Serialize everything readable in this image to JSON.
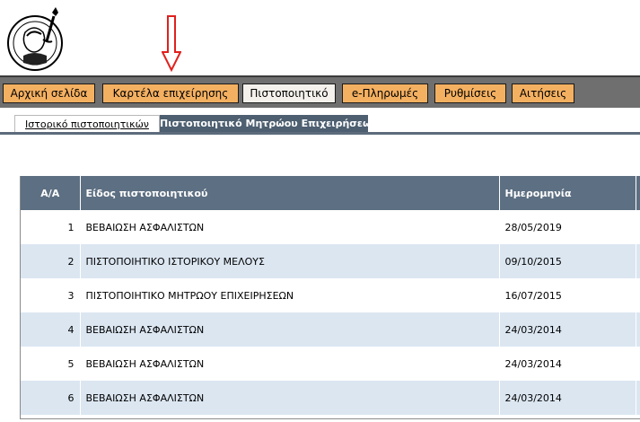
{
  "logo": {
    "alt": "Seal logo",
    "seal_text": "ΠΡΟΜΗΘΕΥΣ"
  },
  "nav": {
    "items": [
      {
        "label": "Αρχική σελίδα",
        "active": false
      },
      {
        "label": "Καρτέλα επιχείρησης",
        "active": false
      },
      {
        "label": "Πιστοποιητικό",
        "active": true
      },
      {
        "label": "e-Πληρωμές",
        "active": false
      },
      {
        "label": "Ρυθμίσεις",
        "active": false
      },
      {
        "label": "Αιτήσεις",
        "active": false
      }
    ]
  },
  "subnav": {
    "active_tab": "Ιστορικό πιστοποιητικών",
    "other_tab": "Πιστοποιητικό Μητρώου Επιχειρήσεων"
  },
  "table": {
    "headers": {
      "aa": "Α/Α",
      "type": "Είδος πιστοποιητικού",
      "date": "Ημερομηνία"
    },
    "rows": [
      {
        "aa": "1",
        "type": "ΒΕΒΑΙΩΣΗ ΑΣΦΑΛΙΣΤΩΝ",
        "date": "28/05/2019"
      },
      {
        "aa": "2",
        "type": "ΠΙΣΤΟΠΟΙΗΤΙΚΟ ΙΣΤΟΡΙΚΟΥ ΜΕΛΟΥΣ",
        "date": "09/10/2015"
      },
      {
        "aa": "3",
        "type": "ΠΙΣΤΟΠΟΙΗΤΙΚΟ ΜΗΤΡΩΟΥ ΕΠΙΧΕΙΡΗΣΕΩΝ",
        "date": "16/07/2015"
      },
      {
        "aa": "4",
        "type": "ΒΕΒΑΙΩΣΗ ΑΣΦΑΛΙΣΤΩΝ",
        "date": "24/03/2014"
      },
      {
        "aa": "5",
        "type": "ΒΕΒΑΙΩΣΗ ΑΣΦΑΛΙΣΤΩΝ",
        "date": "24/03/2014"
      },
      {
        "aa": "6",
        "type": "ΒΕΒΑΙΩΣΗ ΑΣΦΑΛΙΣΤΩΝ",
        "date": "24/03/2014"
      }
    ]
  },
  "colors": {
    "nav_bg": "#f4b061",
    "header_bg": "#5d6f82",
    "stripe": "#dbe6f1",
    "arrow": "#e0201c"
  }
}
